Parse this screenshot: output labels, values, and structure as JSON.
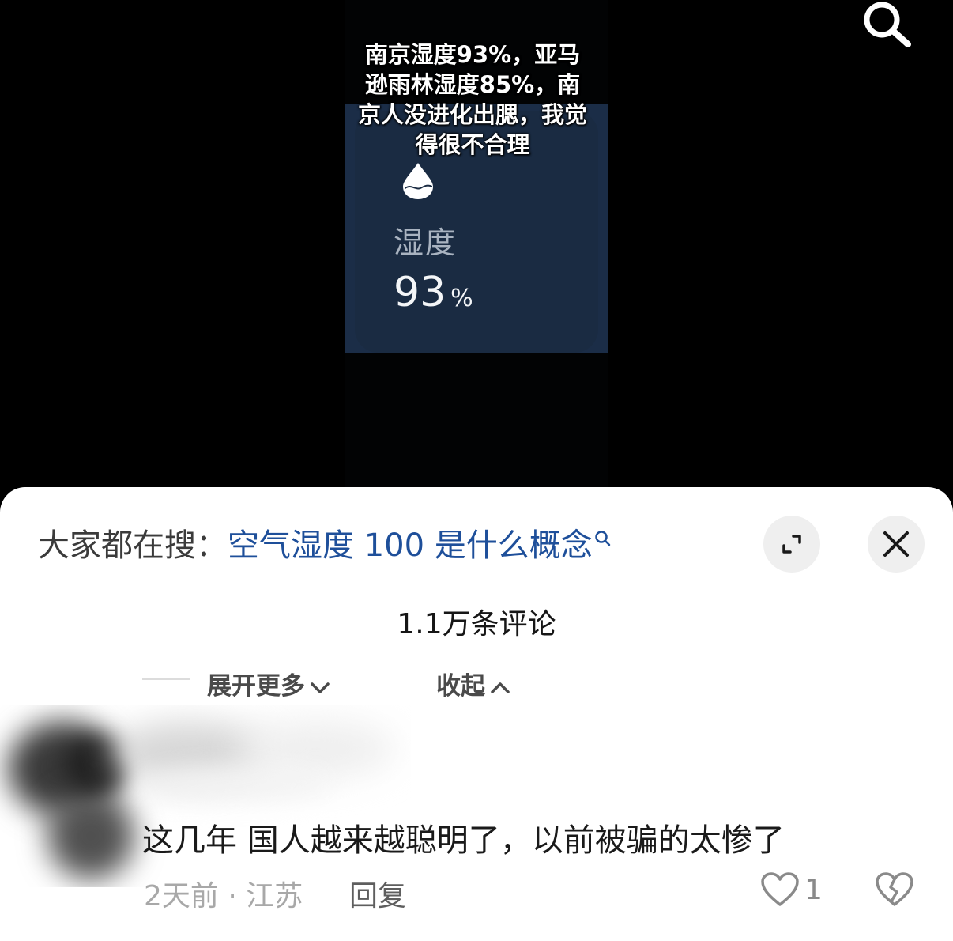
{
  "video": {
    "caption": "南京湿度93%，亚马逊雨林湿度85%，南京人没进化出腮，我觉得很不合理",
    "card": {
      "label": "湿度",
      "value": "93",
      "unit": "%"
    }
  },
  "top_bar": {
    "search_icon": "search-icon"
  },
  "comments_panel": {
    "trending_prefix": "大家都在搜：",
    "trending_query": "空气湿度 100 是什么概念",
    "expand_icon": "expand-icon",
    "close_icon": "close-icon",
    "comment_count": "1.1万条评论",
    "expand_more_label": "展开更多",
    "collapse_label": "收起"
  },
  "comment": {
    "text": "这几年 国人越来越聪明了，以前被骗的太惨了",
    "meta": "2天前 · 江苏",
    "reply_label": "回复",
    "like_count": "1",
    "like_icon": "heart-icon",
    "dislike_icon": "broken-heart-icon"
  }
}
